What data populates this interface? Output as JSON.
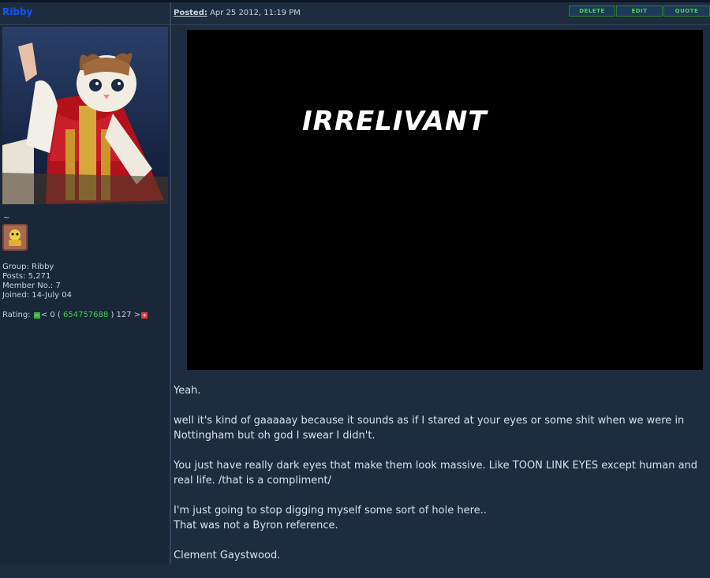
{
  "author": {
    "name": "Ribby"
  },
  "header": {
    "posted_label": "Posted:",
    "posted_date": "Apr 25 2012, 11:19 PM"
  },
  "buttons": {
    "delete": "DELETE",
    "edit": "EDIT",
    "quote": "QUOTE"
  },
  "profile": {
    "tilde": "~",
    "group": "Group: Ribby",
    "posts": "Posts: 5,271",
    "member_no": "Member No.: 7",
    "joined": "Joined: 14-July 04"
  },
  "rating": {
    "label": "Rating:",
    "pre": "< 0 (",
    "value": "654757688",
    "post": ") 127 >"
  },
  "image_text": "IRRELIVANT",
  "post_lines": {
    "p1": "Yeah.",
    "p2": "well it's kind of gaaaaay because it sounds as if I stared at your eyes or some shit when we were in Nottingham but oh god I swear I didn't.",
    "p3": "You just have really dark eyes that make them look massive. Like TOON LINK EYES except human and real life. /that is a compliment/",
    "p4a": "I'm just going to stop digging myself some sort of hole here..",
    "p4b": "That was not a Byron reference.",
    "p5": "Clement Gaystwood."
  },
  "colors": {
    "bg": "#1e2c40",
    "username": "#1155ff",
    "button_text": "#4fd04f",
    "rating_value": "#3fd24a"
  }
}
